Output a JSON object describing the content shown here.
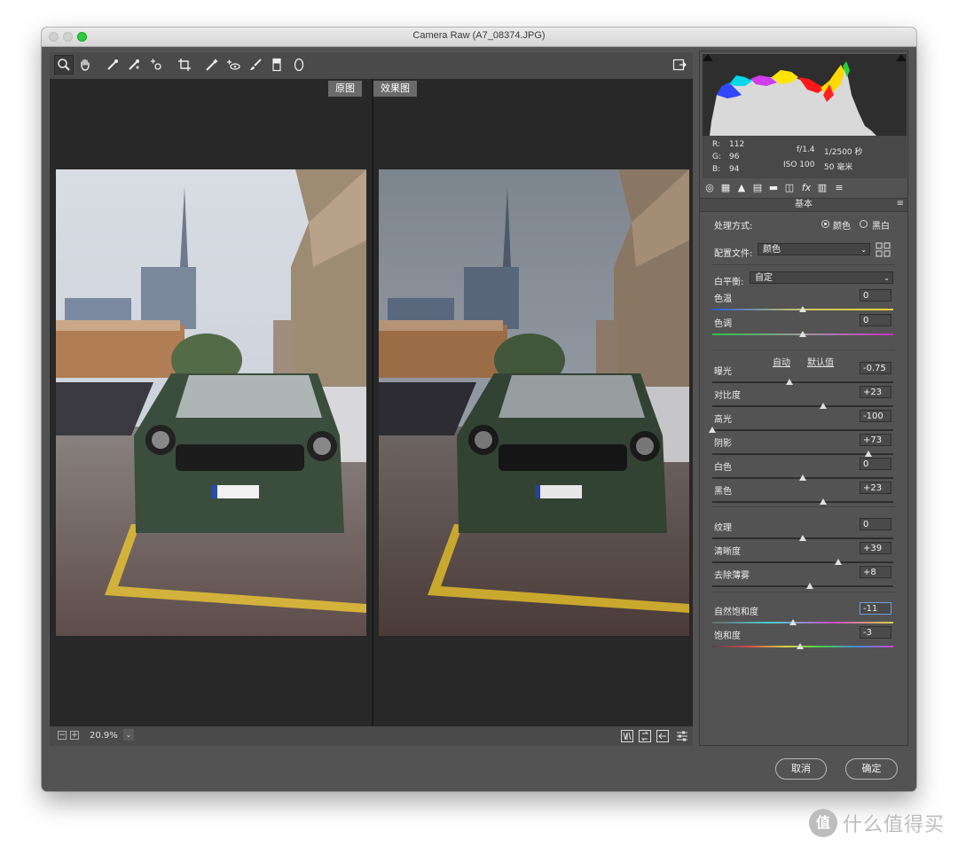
{
  "window": {
    "title": "Camera Raw (A7_08374.JPG)"
  },
  "toolbar": {
    "tools": [
      "zoom-tool",
      "hand-tool",
      "white-balance-tool",
      "color-sampler-tool",
      "targeted-adjustment-tool",
      "crop-tool",
      "straighten-tool",
      "spot-removal-tool",
      "red-eye-tool",
      "adjustment-brush-tool",
      "graduated-filter-tool",
      "radial-filter-tool"
    ],
    "export_icon": "open-preferences-icon"
  },
  "preview": {
    "before_label": "原图",
    "after_label": "效果图",
    "zoom": "20.9%"
  },
  "histogram": {
    "r_label": "R:",
    "g_label": "G:",
    "b_label": "B:",
    "r": "112",
    "g": "96",
    "b": "94",
    "aperture": "f/1.4",
    "shutter": "1/2500 秒",
    "iso": "ISO 100",
    "focal": "50 毫米"
  },
  "panel": {
    "section_title": "基本",
    "treatment_label": "处理方式:",
    "treatment_color": "颜色",
    "treatment_bw": "黑白",
    "profile_label": "配置文件:",
    "profile_value": "颜色",
    "wb_label": "白平衡:",
    "wb_value": "自定",
    "auto_label": "自动",
    "default_label": "默认值",
    "sliders": [
      {
        "label": "色温",
        "value": "0",
        "pos": 0.5
      },
      {
        "label": "色调",
        "value": "0",
        "pos": 0.5
      },
      {
        "label": "曝光",
        "value": "-0.75",
        "pos": 0.425
      },
      {
        "label": "对比度",
        "value": "+23",
        "pos": 0.615
      },
      {
        "label": "高光",
        "value": "-100",
        "pos": 0.0
      },
      {
        "label": "阴影",
        "value": "+73",
        "pos": 0.865
      },
      {
        "label": "白色",
        "value": "0",
        "pos": 0.5
      },
      {
        "label": "黑色",
        "value": "+23",
        "pos": 0.615
      },
      {
        "label": "纹理",
        "value": "0",
        "pos": 0.5
      },
      {
        "label": "清晰度",
        "value": "+39",
        "pos": 0.695
      },
      {
        "label": "去除薄雾",
        "value": "+8",
        "pos": 0.54
      },
      {
        "label": "自然饱和度",
        "value": "-11",
        "pos": 0.445
      },
      {
        "label": "饱和度",
        "value": "-3",
        "pos": 0.485
      }
    ]
  },
  "buttons": {
    "cancel": "取消",
    "ok": "确定"
  },
  "watermark": {
    "logo": "值",
    "text": "什么值得买"
  }
}
